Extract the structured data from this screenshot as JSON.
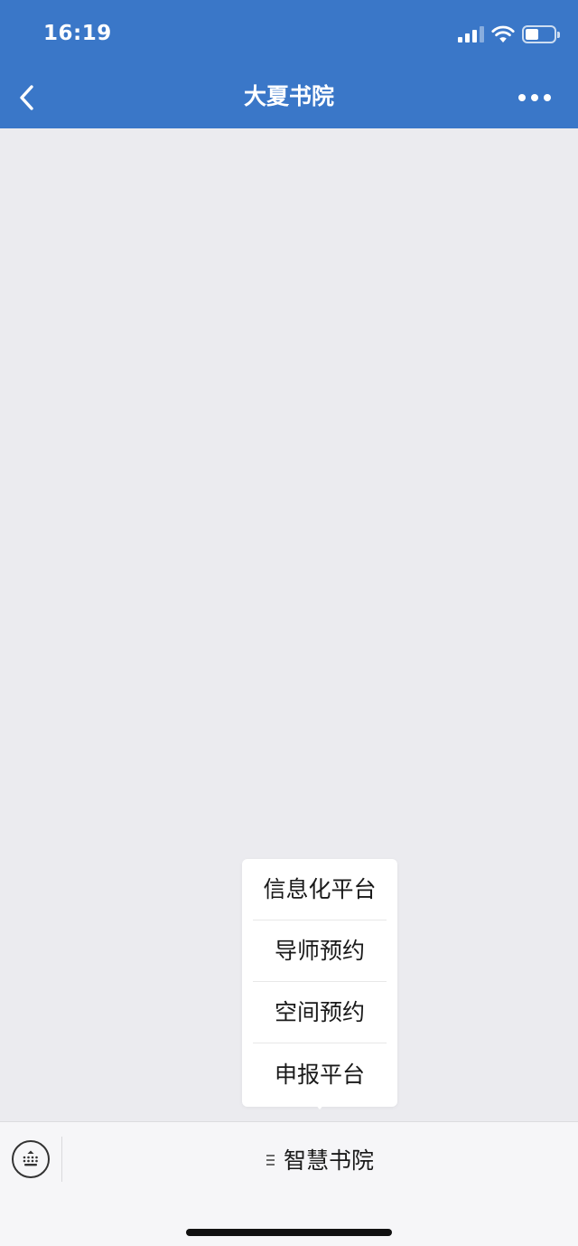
{
  "status_bar": {
    "time": "16:19",
    "icons": [
      "signal-icon",
      "wifi-icon",
      "battery-icon"
    ],
    "battery_level": 0.45
  },
  "nav_bar": {
    "title": "大夏书院",
    "back_icon": "chevron-left-icon",
    "more_icon": "more-horizontal-icon"
  },
  "submenu": {
    "items": [
      {
        "label": "信息化平台"
      },
      {
        "label": "导师预约"
      },
      {
        "label": "空间预约"
      },
      {
        "label": "申报平台"
      }
    ]
  },
  "bottom_menu": {
    "keyboard_icon": "keyboard-toggle-icon",
    "tab_icon": "menu-lines-icon",
    "tab_label": "智慧书院"
  },
  "colors": {
    "header_bg": "#3a77c8",
    "content_bg": "#ebebef",
    "menu_bg": "#ffffff",
    "bottom_bar_bg": "#f6f6f8",
    "text": "#1a1a1a"
  }
}
